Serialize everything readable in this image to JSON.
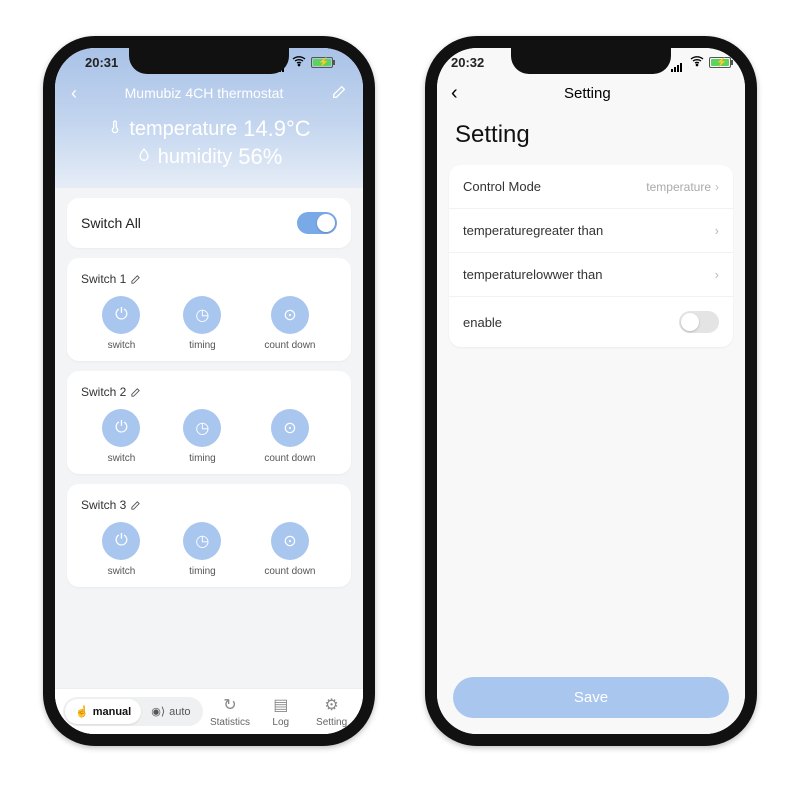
{
  "left": {
    "status_time": "20:31",
    "nav_title": "Mumubiz 4CH thermostat",
    "temperature_label": "temperature",
    "temperature_value": "14.9°C",
    "humidity_label": "humidity",
    "humidity_value": "56%",
    "switch_all_label": "Switch All",
    "switch_all_on": true,
    "channels": [
      {
        "title": "Switch 1",
        "acts": [
          "switch",
          "timing",
          "count down"
        ]
      },
      {
        "title": "Switch 2",
        "acts": [
          "switch",
          "timing",
          "count down"
        ]
      },
      {
        "title": "Switch 3",
        "acts": [
          "switch",
          "timing",
          "count down"
        ]
      }
    ],
    "bottom": {
      "manual": "manual",
      "auto": "auto",
      "statistics": "Statistics",
      "log": "Log",
      "setting": "Setting"
    }
  },
  "right": {
    "status_time": "20:32",
    "nav_title": "Setting",
    "page_title": "Setting",
    "rows": {
      "control_mode_label": "Control Mode",
      "control_mode_value": "temperature",
      "gt": "temperaturegreater than",
      "lt": "temperaturelowwer than",
      "enable": "enable"
    },
    "enable_on": false,
    "save": "Save"
  }
}
